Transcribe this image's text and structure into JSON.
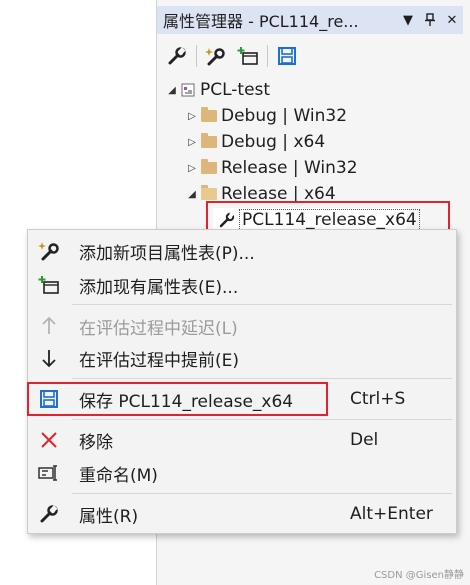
{
  "panel": {
    "title": "属性管理器 - PCL114_re...",
    "header_buttons": [
      "chevron-down-icon",
      "pin-icon",
      "close-icon"
    ],
    "toolbar": [
      "properties-wrench-icon",
      "add-new-property-sheet-icon",
      "add-existing-property-sheet-icon",
      "save-icon"
    ]
  },
  "tree": {
    "project": "PCL-test",
    "configs": [
      {
        "label": "Debug | Win32",
        "expanded": false
      },
      {
        "label": "Debug | x64",
        "expanded": false
      },
      {
        "label": "Release | Win32",
        "expanded": false
      },
      {
        "label": "Release | x64",
        "expanded": true
      }
    ],
    "selected_item": "PCL114_release_x64"
  },
  "menu": {
    "items": [
      {
        "label": "添加新项目属性表(P)...",
        "shortcut": "",
        "icon": "add-new-property-sheet-icon",
        "enabled": true
      },
      {
        "label": "添加现有属性表(E)...",
        "shortcut": "",
        "icon": "add-existing-property-sheet-icon",
        "enabled": true
      },
      {
        "label": "在评估过程中延迟(L)",
        "shortcut": "",
        "icon": "arrow-up-icon",
        "enabled": false
      },
      {
        "label": "在评估过程中提前(E)",
        "shortcut": "",
        "icon": "arrow-down-icon",
        "enabled": true
      },
      {
        "label": "保存 PCL114_release_x64",
        "shortcut": "Ctrl+S",
        "icon": "save-icon",
        "enabled": true
      },
      {
        "label": "移除",
        "shortcut": "Del",
        "icon": "remove-x-icon",
        "enabled": true
      },
      {
        "label": "重命名(M)",
        "shortcut": "",
        "icon": "rename-icon",
        "enabled": true
      },
      {
        "label": "属性(R)",
        "shortcut": "Alt+Enter",
        "icon": "properties-wrench-icon",
        "enabled": true
      }
    ]
  },
  "watermark": "CSDN @Gisen静静",
  "colors": {
    "highlight_border": "#e0232d",
    "header_bg": "#dce4f3",
    "save_icon": "#1e6fd0",
    "remove_icon": "#e0232d"
  }
}
